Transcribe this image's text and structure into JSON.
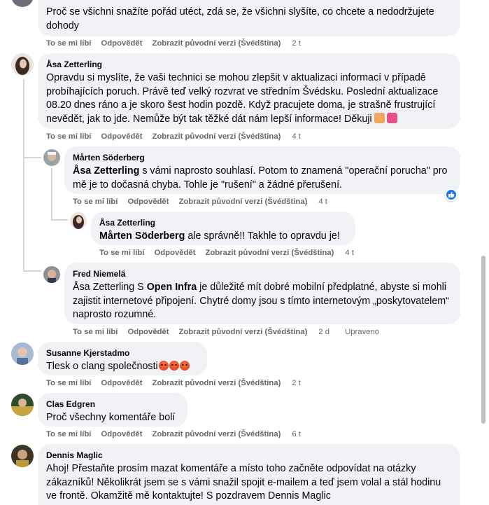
{
  "actions": {
    "like": "To se mi líbí",
    "reply": "Odpovědět",
    "original": "Zobrazit původní verzi (Švédština)",
    "edited": "Upraveno"
  },
  "comments": [
    {
      "author": "",
      "text": "Proč se všichni snažíte pořád utéct, zdá se, že všichni slyšíte, co chcete a nedodržujete dohody",
      "time": "2 t"
    },
    {
      "author": "Åsa Zetterling",
      "text": "Opravdu si myslíte, že vaši technici se mohou zlepšit v aktualizaci informací v případě probíhajících poruch. Právě teď velký rozvrat ve středním Švédsku. Poslední aktualizace 08.20 dnes ráno a je skoro šest hodin pozdě. Když pracujete doma, je strašně frustrující nevědět, jak to jde. Nemůže být tak těžké dát nám lepší informace! Děkuji",
      "time": "4 t"
    },
    {
      "author": "Mårten Söderberg",
      "mention": "Åsa Zetterling",
      "text": " s vámi naprosto souhlasí. Potom to znamená \"operační porucha\" pro mě je to dočasná chyba. Tohle je \"rušení\" a žádné přerušení.",
      "time": "4 t"
    },
    {
      "author": "Åsa Zetterling",
      "mention": "Mårten Söderberg",
      "text": " ale správně!! Takhle to opravdu je!",
      "time": "4 t"
    },
    {
      "author": "Fred Niemelä",
      "text_a": "Åsa Zetterling S ",
      "mention": "Open Infra",
      "text_b": " je důležité mít dobré mobilní předplatné, abyste si mohli zajistit internetové připojení. Chytré domy jsou s tímto internetovým „poskytovatelem“ naprosto rozumné.",
      "time": "2 d"
    },
    {
      "author": "Susanne Kjerstadmo",
      "text": "Tlesk o clang společnosti",
      "time": "2 t"
    },
    {
      "author": "Clas Edgren",
      "text": "Proč všechny komentáře bolí",
      "time": "6 t"
    },
    {
      "author": "Dennis Maglic",
      "text": "Ahoj! Přestaňte prosím mazat komentáře a místo toho začněte odpovídat na otázky zákazníků! Několikrát jsem se s vámi snažil spojit e-mailem a teď jsem volal a stál hodinu ve frontě. Okamžitě mě kontaktujte! S pozdravem Dennis Maglic"
    }
  ],
  "colors": {
    "bubble": "#f0f2f5",
    "meta": "#65676b",
    "like": "#1877f2"
  },
  "icons": [
    "woman-facepalming-emoji",
    "female-sign-emoji",
    "angry-face-emoji",
    "like-reaction-icon"
  ]
}
